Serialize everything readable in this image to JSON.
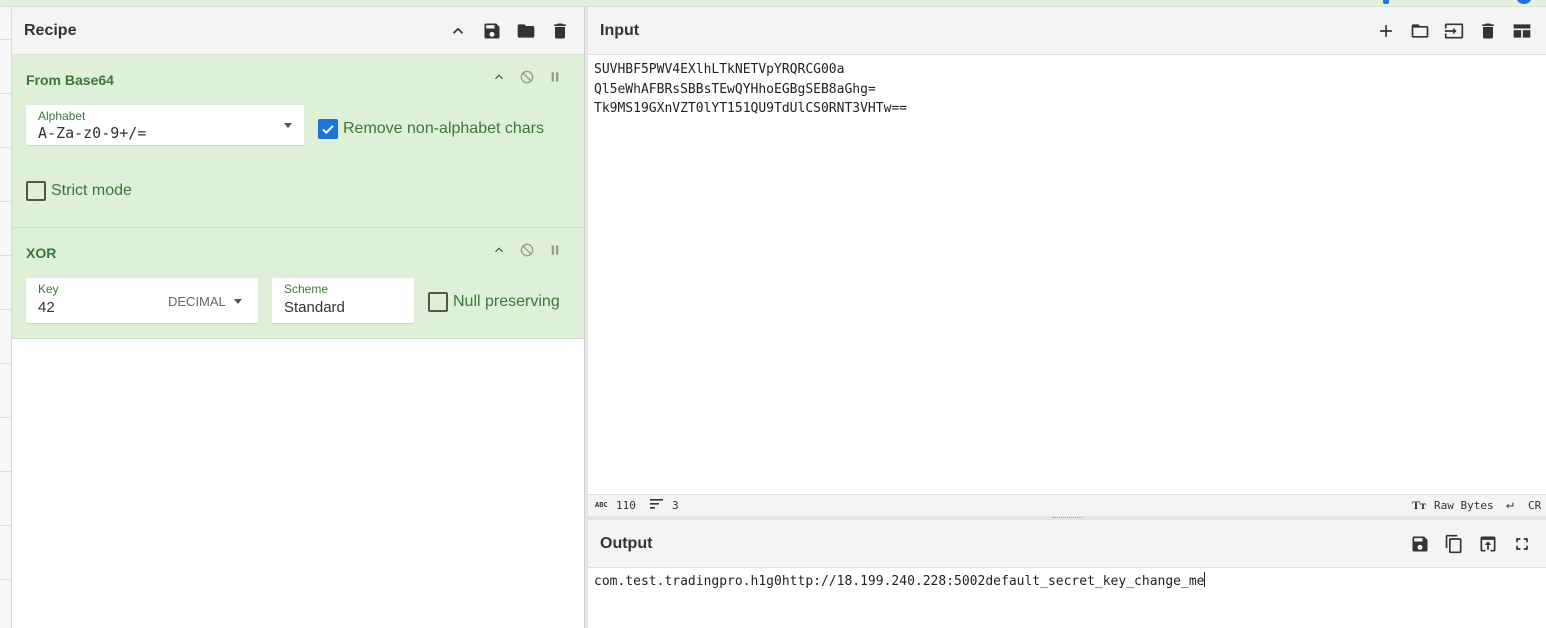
{
  "recipe": {
    "title": "Recipe",
    "operations": [
      {
        "name": "From Base64",
        "alphabet_label": "Alphabet",
        "alphabet_value": "A-Za-z0-9+/=",
        "remove_nonalpha_label": "Remove non-alphabet chars",
        "remove_nonalpha_checked": true,
        "strict_label": "Strict mode",
        "strict_checked": false
      },
      {
        "name": "XOR",
        "key_label": "Key",
        "key_value": "42",
        "key_format": "DECIMAL",
        "scheme_label": "Scheme",
        "scheme_value": "Standard",
        "null_label": "Null preserving",
        "null_checked": false
      }
    ]
  },
  "input": {
    "title": "Input",
    "lines": [
      "SUVHBF5PWV4EXlhLTkNETVpYRQRCG00a",
      "Ql5eWhAFBRsSBBsTEwQYHhoEGBgSEB8aGhg=",
      "Tk9MS19GXnVZT0lYT151QU9TdUlCS0RNT3VHTw=="
    ],
    "status": {
      "length": "110",
      "line_count": "3",
      "encoding": "Raw Bytes",
      "eol": "CR"
    }
  },
  "output": {
    "title": "Output",
    "text": "com.test.tradingpro.h1g0http://18.199.240.228:5002default_secret_key_change_me"
  },
  "colors": {
    "op_bg": "#dff0d8",
    "op_text": "#3c763d",
    "checkbox_on": "#1e73d8",
    "header_bg": "#f4f4f4"
  }
}
